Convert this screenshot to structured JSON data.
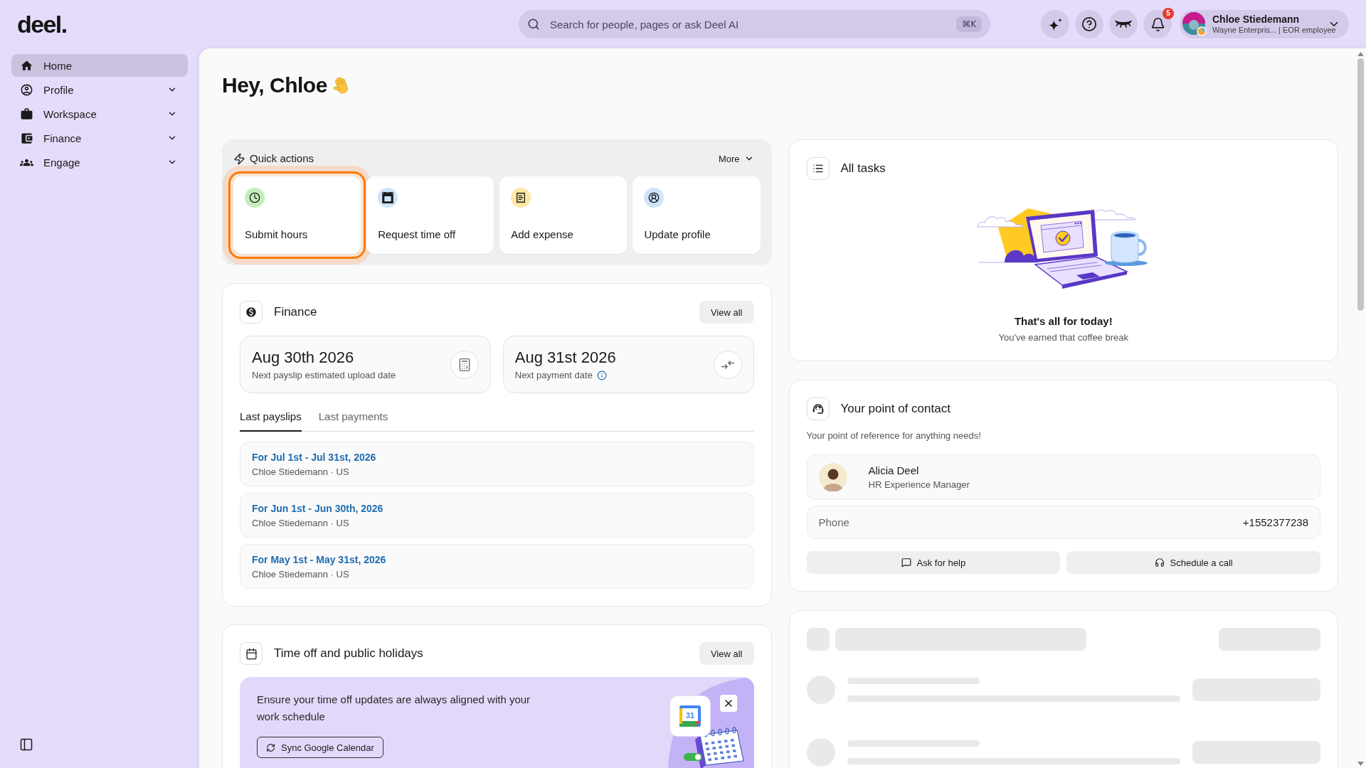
{
  "logo": "deel.",
  "search": {
    "placeholder": "Search for people, pages or ask Deel AI",
    "shortcut": "⌘K"
  },
  "notifications": {
    "count": "5"
  },
  "user": {
    "name": "Chloe Stiedemann",
    "subtitle": "Wayne Enterpris... | EOR employee"
  },
  "sidebar": {
    "items": [
      {
        "label": "Home",
        "selected": true,
        "expandable": false
      },
      {
        "label": "Profile",
        "selected": false,
        "expandable": true
      },
      {
        "label": "Workspace",
        "selected": false,
        "expandable": true
      },
      {
        "label": "Finance",
        "selected": false,
        "expandable": true
      },
      {
        "label": "Engage",
        "selected": false,
        "expandable": true
      }
    ]
  },
  "greeting": "Hey, Chloe",
  "quick_actions": {
    "title": "Quick actions",
    "more": "More",
    "actions": [
      {
        "label": "Submit hours",
        "color": "#c4edbc",
        "highlighted": true
      },
      {
        "label": "Request time off",
        "color": "#cfe4fb",
        "highlighted": false
      },
      {
        "label": "Add expense",
        "color": "#fde8a4",
        "highlighted": false
      },
      {
        "label": "Update profile",
        "color": "#cfe4fb",
        "highlighted": false
      }
    ]
  },
  "finance": {
    "title": "Finance",
    "view_all": "View all",
    "stats": [
      {
        "kind": "payslip",
        "value": "Aug 30th 2026",
        "caption": "Next payslip estimated upload date",
        "info": false
      },
      {
        "kind": "payment",
        "value": "Aug 31st 2026",
        "caption": "Next payment date",
        "info": true
      }
    ],
    "tabs": [
      {
        "label": "Last payslips",
        "selected": true
      },
      {
        "label": "Last payments",
        "selected": false
      }
    ],
    "payslips": [
      {
        "period": "For Jul 1st - Jul 31st, 2026",
        "details": "Chloe Stiedemann · US"
      },
      {
        "period": "For Jun 1st - Jun 30th, 2026",
        "details": "Chloe Stiedemann · US"
      },
      {
        "period": "For May 1st - May 31st, 2026",
        "details": "Chloe Stiedemann · US"
      }
    ]
  },
  "time_off": {
    "title": "Time off and public holidays",
    "view_all": "View all",
    "banner": {
      "text": "Ensure your time off updates are always aligned with your work schedule",
      "button": "Sync Google Calendar",
      "calendar_day": "31"
    }
  },
  "tasks": {
    "title": "All tasks",
    "empty_title": "That's all for today!",
    "empty_subtitle": "You've earned that coffee break"
  },
  "contact": {
    "title": "Your point of contact",
    "description": "Your point of reference for anything needs!",
    "person": {
      "name": "Alicia Deel",
      "role": "HR Experience Manager"
    },
    "phone": {
      "label": "Phone",
      "value": "+1552377238"
    },
    "buttons": [
      {
        "kind": "chat",
        "label": "Ask for help"
      },
      {
        "kind": "call",
        "label": "Schedule a call"
      }
    ]
  }
}
